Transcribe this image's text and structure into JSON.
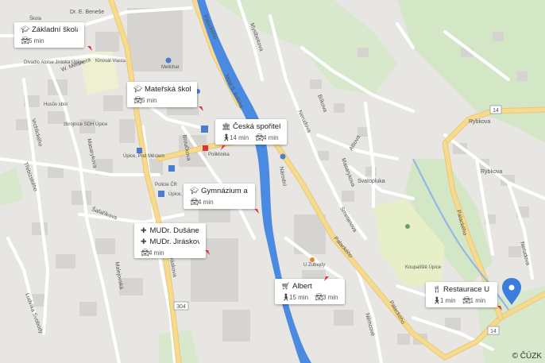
{
  "map": {
    "streets": {
      "palackeho": "Palackého",
      "most_5_kvetna": "Most 5. května",
      "nemeckeho": "Němcové",
      "myslbekova": "Myslbekova",
      "vrchlickeho": "Vrchlického",
      "bilkova": "Bílkova",
      "nerudova": "Nerudova",
      "alsova": "Alšova",
      "masarykova": "Masarykova",
      "trebizskeho": "Třebízského",
      "svatopluka": "Svatopluka",
      "jiraskova": "Jiráskova",
      "smetanova": "Smetanova",
      "tyrsova": "Tyršova",
      "rybkova": "Rybkova",
      "dr_e_benese": "Dr. E. Beneše",
      "u_mlyna": "U Mlýna",
      "ludvika_svobody": "Ludvíka Svobody",
      "narodni": "Národní",
      "nemcove": "Němcové",
      "sasankova": "Šafaříkova",
      "w_meisnera": "W. Meisnera",
      "malejovska": "Malejovská",
      "brouckova": "Broučkova"
    },
    "pois": {
      "skola": "Škola",
      "divadlo": "Divadlo Aloise Jiráska Úpice",
      "kinosal": "Kinosál Vlasta",
      "melichar": "Melichar",
      "husuv_sbor": "Husův sbor",
      "hasici": "zbrojnice SDH Úpice",
      "posta": "Úpice, Pod Městem",
      "policie": "Policie ČR",
      "poliklinika": "Poliklinika",
      "u_zubejdy": "U Zubejdy",
      "koupaliste": "Koupaliště Úpice",
      "kino": "Úpice, Kino"
    },
    "road_number": "304",
    "road_number_2": "14",
    "road_number_3": "14"
  },
  "cards": [
    {
      "id": "zakladni",
      "icon": "school-icon",
      "title": "Základní škola br…",
      "walk": null,
      "car": "5 min"
    },
    {
      "id": "materska",
      "icon": "school-icon",
      "title": "Mateřská škola Ú…",
      "walk": null,
      "car": "5 min"
    },
    {
      "id": "sporitelna",
      "icon": "bank-icon",
      "title": "Česká spořitelna",
      "walk": "14 min",
      "car": "4 min"
    },
    {
      "id": "gymnazium",
      "icon": "school-icon",
      "title": "Gymnázium a stř…",
      "walk": null,
      "car": "4 min"
    },
    {
      "id": "mudr",
      "icon": "medical-icon",
      "title": "MUDr. Dušánek R…",
      "title2": "MUDr. Jirásková E…",
      "walk": null,
      "car": "4 min"
    },
    {
      "id": "albert",
      "icon": "cart-icon",
      "title": "Albert",
      "walk": "15 min",
      "car": "3 min"
    },
    {
      "id": "restaurace",
      "icon": "restaurant-icon",
      "title": "Restaurace U Ma…",
      "walk": "1 min",
      "car": "1 min"
    }
  ],
  "attribution": "© ČÚZK",
  "colors": {
    "river": "#4a8ae0",
    "main_road": "#f5d78a",
    "road": "#ffffff",
    "park": "#cfe6c2",
    "building": "#d9d7d3",
    "marker": "#3b7ddd",
    "direction_arrow": "#d9343d"
  }
}
